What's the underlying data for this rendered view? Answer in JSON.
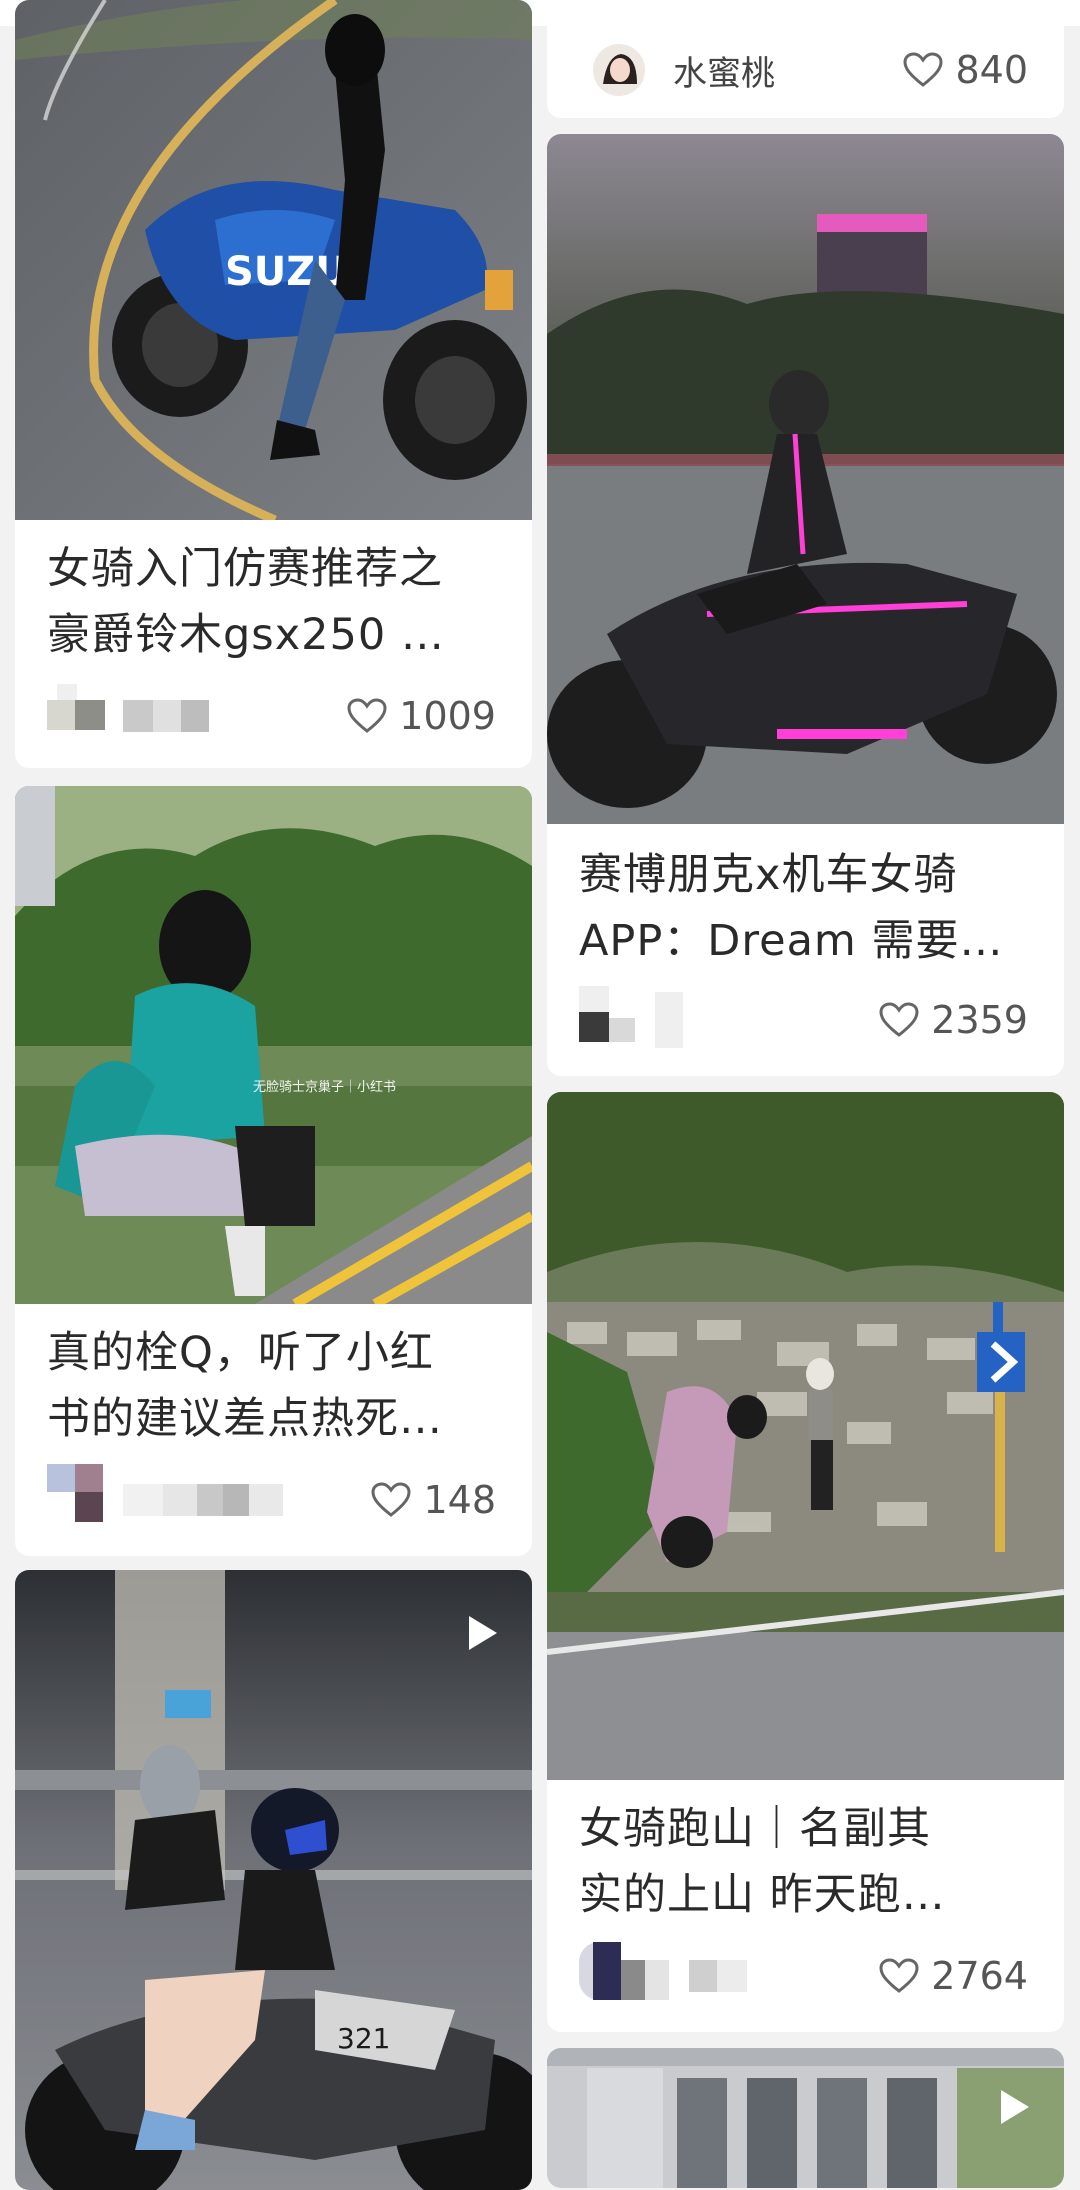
{
  "cards": [
    {
      "title": "女骑入门仿赛推荐之\n豪爵铃木gsx250 …",
      "likes": "1009"
    },
    {
      "author": "水蜜桃",
      "likes": "840"
    },
    {
      "title": "赛博朋克x机车女骑\nAPP：Dream 需要…",
      "likes": "2359"
    },
    {
      "title": "真的栓Q，听了小红\n书的建议差点热死…",
      "likes": "148",
      "watermark": "无脸骑士京巢子｜小红书"
    },
    {
      "title": "女骑跑山｜名副其\n实的上山 昨天跑…",
      "likes": "2764"
    },
    {
      "badge_text": "SUZU"
    }
  ],
  "colors": {
    "background": "#f2f2f2",
    "card": "#ffffff",
    "text": "#2a2a2a",
    "muted": "#555555"
  },
  "icons": {
    "like": "heart-outline-icon",
    "video": "play-icon"
  }
}
